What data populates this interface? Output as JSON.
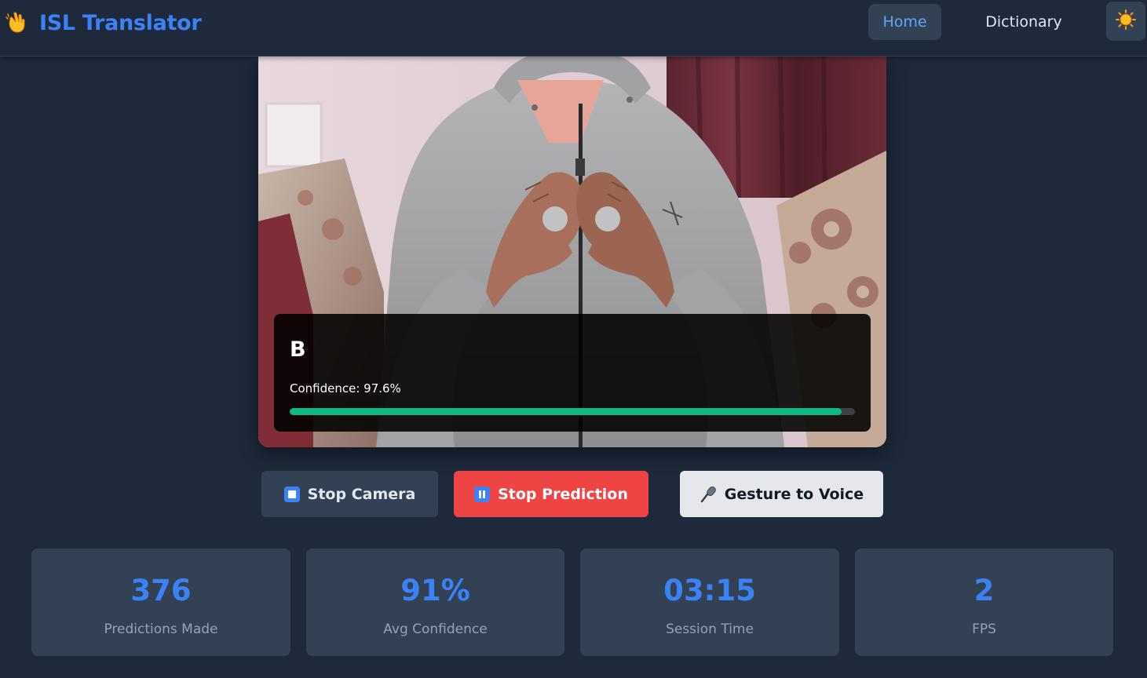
{
  "navbar": {
    "brand_title": "ISL Translator",
    "brand_icon": "hand-sign-icon",
    "home_label": "Home",
    "dictionary_label": "Dictionary",
    "theme_icon": "sun-icon"
  },
  "prediction": {
    "letter": "B",
    "confidence_text": "Confidence: 97.6%",
    "confidence_value": 0.976
  },
  "controls": {
    "stop_camera_label": "Stop Camera",
    "stop_prediction_label": "Stop Prediction",
    "gesture_voice_label": "Gesture to Voice"
  },
  "stats": [
    {
      "value": "376",
      "label": "Predictions Made"
    },
    {
      "value": "91%",
      "label": "Avg Confidence"
    },
    {
      "value": "03:15",
      "label": "Session Time"
    },
    {
      "value": "2",
      "label": "FPS"
    }
  ],
  "colors": {
    "accent": "#3b82f6",
    "background": "#1e293b",
    "card": "#334155",
    "danger": "#ef4444",
    "success": "#10b981"
  }
}
